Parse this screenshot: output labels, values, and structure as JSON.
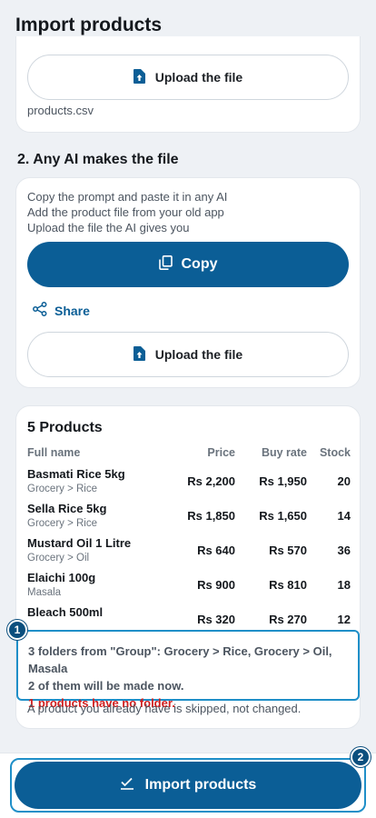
{
  "header": {
    "title": "Import products"
  },
  "step1": {
    "upload_label": "Upload the file",
    "file_name": "products.csv"
  },
  "step2": {
    "heading": "2. Any AI makes the file",
    "prompt_lines": [
      "Copy the prompt and paste it in any AI",
      "Add the product file from your old app",
      "Upload the file the AI gives you"
    ],
    "copy_label": "Copy",
    "share_label": "Share",
    "upload_label": "Upload the file"
  },
  "products": {
    "title": "5 Products",
    "columns": {
      "name": "Full name",
      "price": "Price",
      "buy_rate": "Buy rate",
      "stock": "Stock"
    },
    "rows": [
      {
        "name": "Basmati Rice 5kg",
        "group": "Grocery > Rice",
        "price": "Rs 2,200",
        "buy_rate": "Rs 1,950",
        "stock": "20"
      },
      {
        "name": "Sella Rice 5kg",
        "group": "Grocery > Rice",
        "price": "Rs 1,850",
        "buy_rate": "Rs 1,650",
        "stock": "14"
      },
      {
        "name": "Mustard Oil 1 Litre",
        "group": "Grocery > Oil",
        "price": "Rs 640",
        "buy_rate": "Rs 570",
        "stock": "36"
      },
      {
        "name": "Elaichi 100g",
        "group": "Masala",
        "price": "Rs 900",
        "buy_rate": "Rs 810",
        "stock": "18"
      },
      {
        "name": "Bleach 500ml",
        "group": "",
        "price": "Rs 320",
        "buy_rate": "Rs 270",
        "stock": "12"
      }
    ],
    "summary_line1": "3 folders from \"Group\": Grocery > Rice, Grocery > Oil, Masala",
    "summary_line2": "2 of them will be made now.",
    "summary_warning": "1 products have no folder.",
    "footnote": "A product you already have is skipped, not changed."
  },
  "badges": {
    "first": "1",
    "second": "2"
  },
  "footer": {
    "import_label": "Import products"
  },
  "colors": {
    "primary": "#0b5e96",
    "highlight": "#1f8fc8",
    "warning": "#d11f1f"
  },
  "icons": {
    "upload": "file-upload-icon",
    "copy": "copy-icon",
    "share": "share-icon",
    "import": "check-import-icon"
  }
}
